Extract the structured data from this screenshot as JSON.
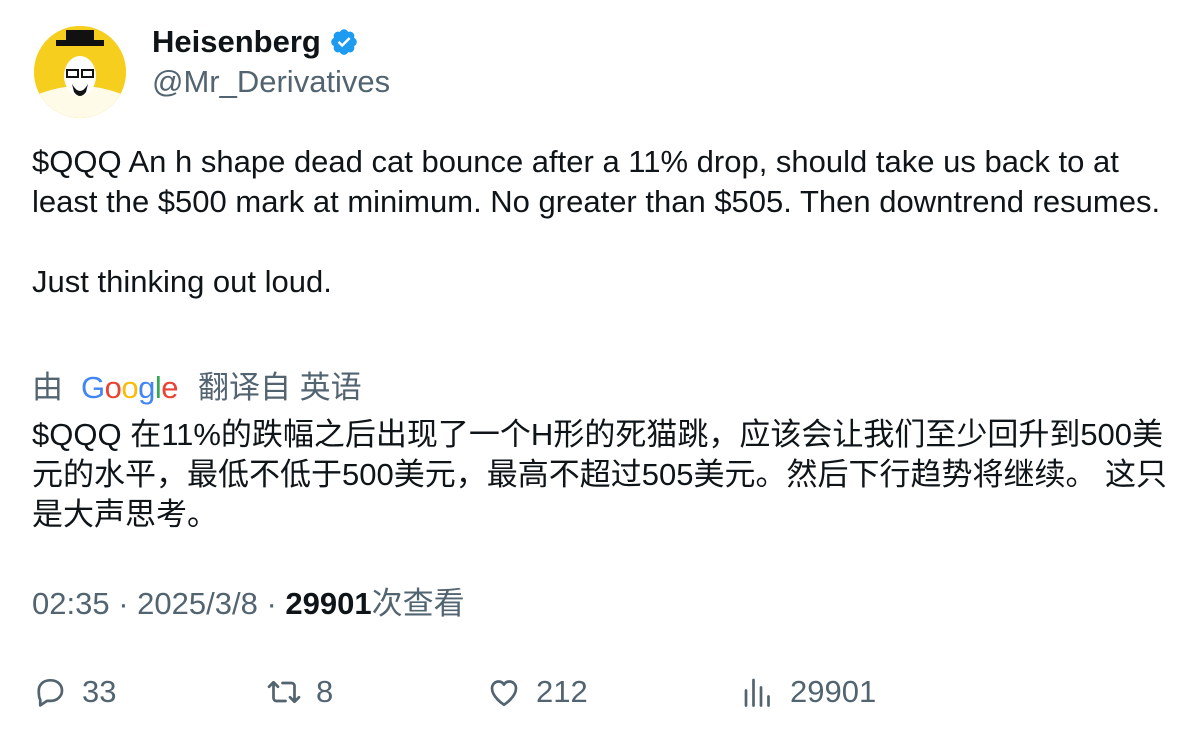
{
  "author": {
    "display_name": "Heisenberg",
    "handle": "@Mr_Derivatives",
    "verified_icon": "verified-badge-icon",
    "verified_color": "#1d9bf0",
    "avatar_color": "#f6cf1e"
  },
  "post": {
    "paragraphs": [
      "$QQQ An h shape dead cat bounce after a 11% drop, should take us back to at least the $500 mark at minimum. No greater than $505. Then downtrend resumes.",
      "Just thinking out loud."
    ],
    "translate_prefix": "由",
    "translate_provider": "Google",
    "translate_suffix": "翻译自 英语",
    "translated_text": "$QQQ 在11%的跌幅之后出现了一个H形的死猫跳，应该会让我们至少回升到500美元的水平，最低不低于500美元，最高不超过505美元。然后下行趋势将继续。 这只是大声思考。"
  },
  "meta": {
    "time": "02:35",
    "separator": "·",
    "date": "2025/3/8",
    "views_count": "29901",
    "views_label": "次查看"
  },
  "actions": {
    "replies": "33",
    "retweets": "8",
    "likes": "212",
    "views": "29901"
  },
  "colors": {
    "text": "#0f1419",
    "secondary": "#536471"
  }
}
